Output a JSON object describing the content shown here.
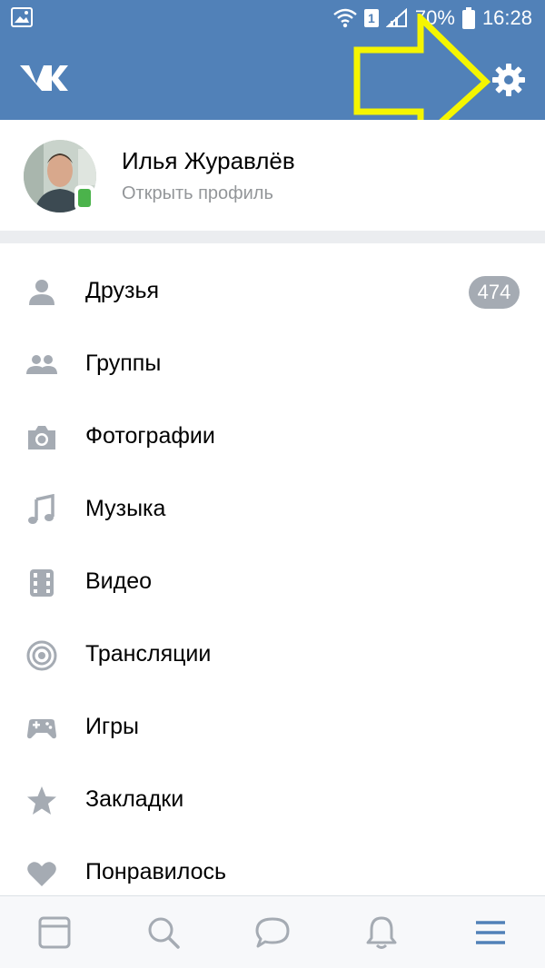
{
  "status_bar": {
    "battery_percent": "70%",
    "time": "16:28",
    "sim_slot": "1",
    "icons": [
      "gallery-icon",
      "wifi-icon",
      "sim-icon",
      "signal-icon",
      "battery-icon"
    ]
  },
  "header": {
    "logo_icon": "vk-logo-icon",
    "settings_icon": "gear-icon",
    "bg_color": "#5181b8"
  },
  "profile": {
    "name": "Илья Журавлёв",
    "subtitle": "Открыть профиль",
    "online_status": "mobile"
  },
  "menu": {
    "items": [
      {
        "label": "Друзья",
        "icon": "person-icon",
        "badge": "474"
      },
      {
        "label": "Группы",
        "icon": "people-icon"
      },
      {
        "label": "Фотографии",
        "icon": "camera-icon"
      },
      {
        "label": "Музыка",
        "icon": "music-note-icon"
      },
      {
        "label": "Видео",
        "icon": "film-icon"
      },
      {
        "label": "Трансляции",
        "icon": "broadcast-icon"
      },
      {
        "label": "Игры",
        "icon": "gamepad-icon"
      },
      {
        "label": "Закладки",
        "icon": "star-icon"
      },
      {
        "label": "Понравилось",
        "icon": "heart-icon"
      }
    ]
  },
  "bottom_nav": {
    "items": [
      "feed-icon",
      "search-icon",
      "messages-icon",
      "notifications-icon",
      "menu-icon"
    ],
    "active": "menu-icon"
  },
  "colors": {
    "accent": "#5181b8",
    "icon_gray": "#a5abb3",
    "annotation": "#f5f500"
  }
}
